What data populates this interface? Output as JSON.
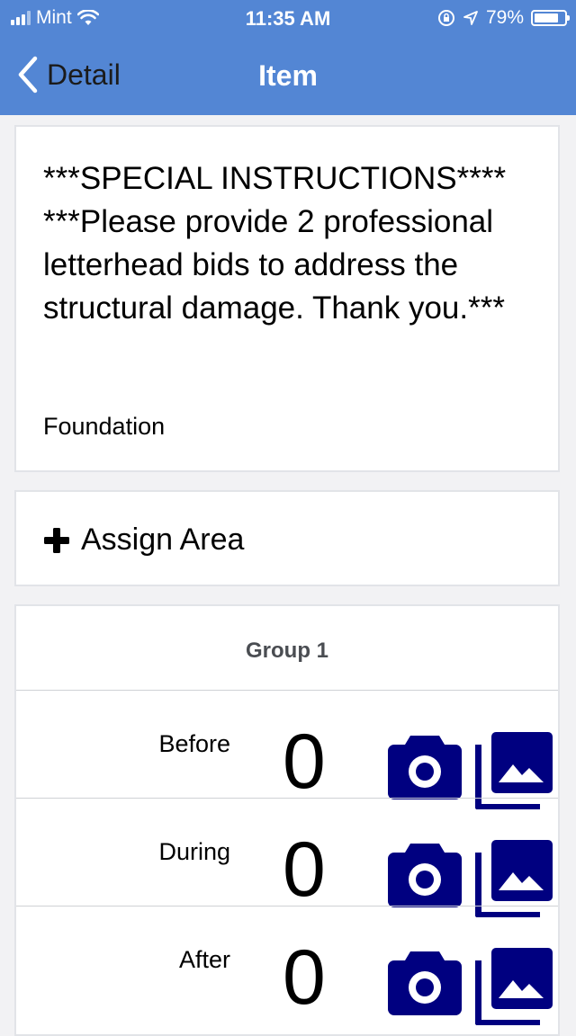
{
  "status": {
    "carrier": "Mint",
    "time": "11:35 AM",
    "battery": "79%"
  },
  "nav": {
    "back_label": "Detail",
    "title": "Item"
  },
  "instructions": {
    "text": "***SPECIAL INSTRUCTIONS**** ***Please provide 2 professional letterhead bids to address the structural damage. Thank you.***",
    "category": "Foundation"
  },
  "assign": {
    "label": "Assign Area"
  },
  "group": {
    "title": "Group 1",
    "rows": [
      {
        "label": "Before",
        "count": "0"
      },
      {
        "label": "During",
        "count": "0"
      },
      {
        "label": "After",
        "count": "0"
      }
    ]
  },
  "icons": {
    "accent": "#000080",
    "camera": "camera-icon",
    "gallery": "gallery-icon"
  }
}
